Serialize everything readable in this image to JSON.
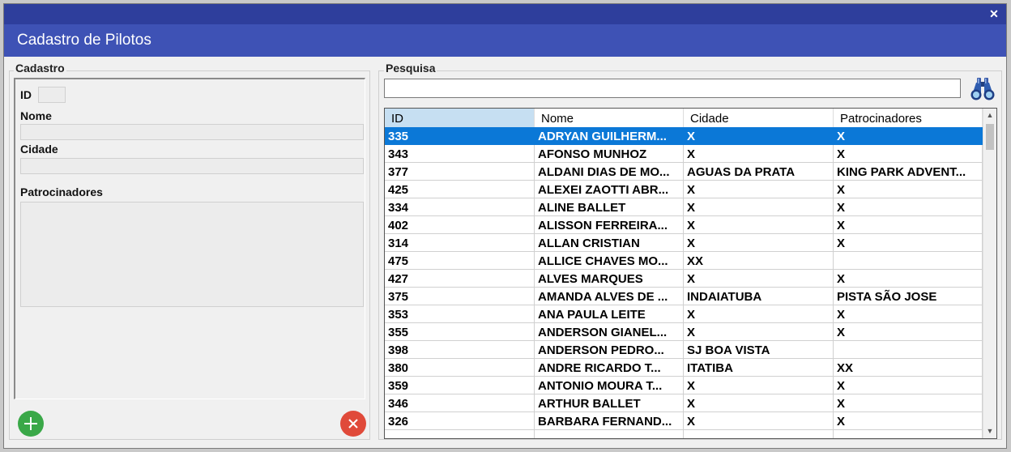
{
  "window": {
    "title": "Cadastro de Pilotos",
    "close_label": "✕"
  },
  "cadastro": {
    "caption": "Cadastro",
    "id_label": "ID",
    "nome_label": "Nome",
    "cidade_label": "Cidade",
    "patrocinadores_label": "Patrocinadores",
    "id_value": "",
    "nome_value": "",
    "cidade_value": "",
    "patrocinadores_value": ""
  },
  "pesquisa": {
    "caption": "Pesquisa",
    "search_value": ""
  },
  "grid": {
    "columns": [
      "ID",
      "Nome",
      "Cidade",
      "Patrocinadores"
    ],
    "rows": [
      [
        "335",
        "ADRYAN GUILHERM...",
        "X",
        "X"
      ],
      [
        "343",
        "AFONSO MUNHOZ",
        "X",
        "X"
      ],
      [
        "377",
        "ALDANI DIAS DE MO...",
        "AGUAS DA PRATA",
        "KING PARK ADVENT..."
      ],
      [
        "425",
        "ALEXEI ZAOTTI ABR...",
        "X",
        "X"
      ],
      [
        "334",
        "ALINE BALLET",
        "X",
        "X"
      ],
      [
        "402",
        "ALISSON FERREIRA...",
        "X",
        "X"
      ],
      [
        "314",
        "ALLAN CRISTIAN",
        "X",
        "X"
      ],
      [
        "475",
        "ALLICE CHAVES MO...",
        "XX",
        ""
      ],
      [
        "427",
        "ALVES MARQUES",
        "X",
        "X"
      ],
      [
        "375",
        "AMANDA ALVES DE ...",
        "INDAIATUBA",
        "PISTA SÃO JOSE"
      ],
      [
        "353",
        "ANA PAULA LEITE",
        "X",
        "X"
      ],
      [
        "355",
        "ANDERSON GIANEL...",
        "X",
        "X"
      ],
      [
        "398",
        "ANDERSON PEDRO...",
        "SJ BOA VISTA",
        ""
      ],
      [
        "380",
        "ANDRE RICARDO T...",
        "ITATIBA",
        "XX"
      ],
      [
        "359",
        "ANTONIO MOURA T...",
        "X",
        "X"
      ],
      [
        "346",
        "ARTHUR BALLET",
        "X",
        "X"
      ],
      [
        "326",
        "BARBARA FERNAND...",
        "X",
        "X"
      ],
      [
        "",
        "",
        "",
        ""
      ]
    ],
    "selected_row": 0
  },
  "colors": {
    "topbar": "#2e3e9c",
    "titlebar": "#3e52b5",
    "selection": "#0b78d7",
    "add_button": "#3aa848",
    "delete_button": "#e04a3a"
  },
  "icons": {
    "close": "close-icon",
    "search": "binoculars-icon",
    "add": "plus-icon",
    "delete": "x-icon"
  }
}
